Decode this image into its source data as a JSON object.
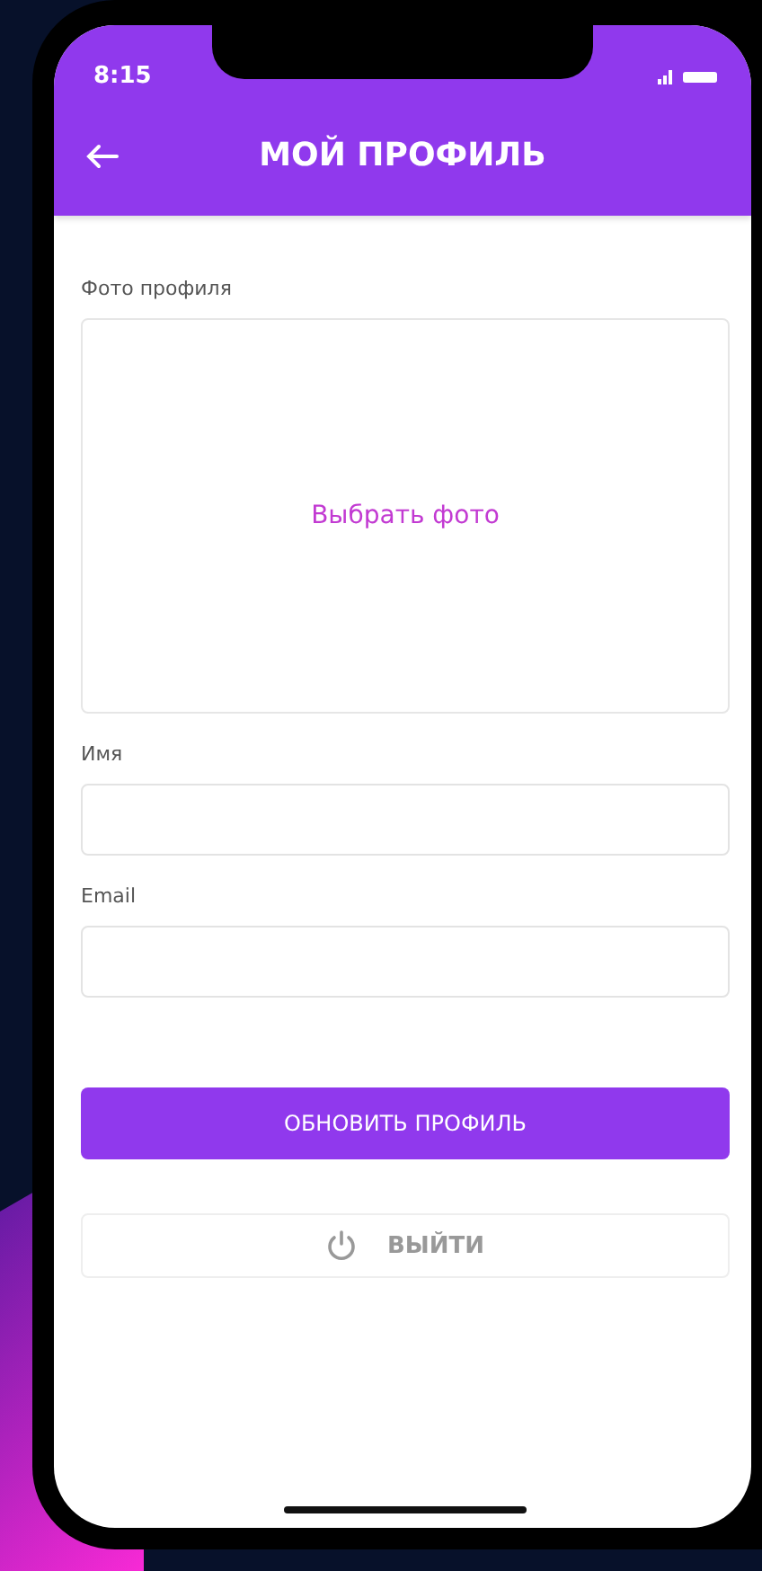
{
  "status_bar": {
    "time": "8:15"
  },
  "header": {
    "title": "МОЙ ПРОФИЛЬ"
  },
  "photo": {
    "label": "Фото профиля",
    "action": "Выбрать фото"
  },
  "fields": [
    {
      "label": "Имя"
    },
    {
      "label": "Email"
    }
  ],
  "buttons": [
    {
      "kind": "primary",
      "label": "ОБНОВИТЬ ПРОФИЛЬ"
    },
    {
      "kind": "logout",
      "label": "ВЫЙТИ"
    }
  ]
}
